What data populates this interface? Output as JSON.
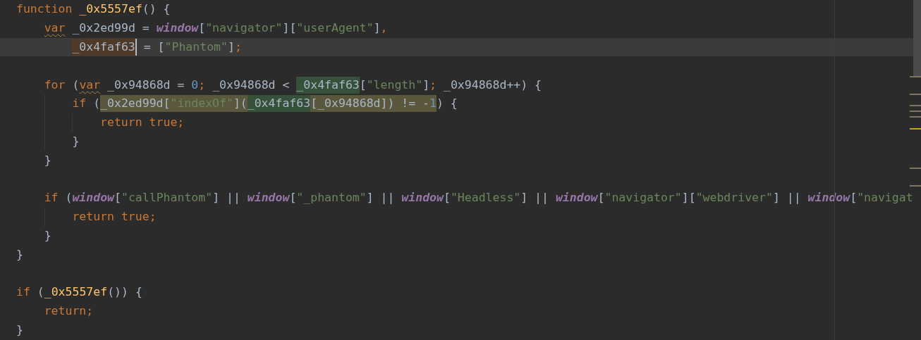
{
  "editor": {
    "lines": [
      {
        "current": false,
        "tokens": [
          {
            "text": "function ",
            "kind": "keyword"
          },
          {
            "text": "_0x5557ef",
            "kind": "function"
          },
          {
            "text": "() {",
            "kind": "plain"
          }
        ],
        "children": [
          {
            "current": false,
            "tokens": [
              {
                "text": "var",
                "kind": "keyword",
                "warning": true
              },
              {
                "text": " _0x2ed99d = ",
                "kind": "plain"
              },
              {
                "text": "window",
                "kind": "global"
              },
              {
                "text": "[",
                "kind": "plain"
              },
              {
                "text": "\"navigator\"",
                "kind": "string"
              },
              {
                "text": "][",
                "kind": "plain"
              },
              {
                "text": "\"userAgent\"",
                "kind": "string"
              },
              {
                "text": "]",
                "kind": "plain"
              },
              {
                "text": ",",
                "kind": "keyword"
              }
            ],
            "children": [
              {
                "current": true,
                "tokens": [
                  {
                    "text": "_0x4faf63",
                    "kind": "plain",
                    "write_usage": true,
                    "caret": true
                  },
                  {
                    "text": " = [",
                    "kind": "plain"
                  },
                  {
                    "text": "\"Phantom\"",
                    "kind": "string"
                  },
                  {
                    "text": "]",
                    "kind": "plain"
                  },
                  {
                    "text": ";",
                    "kind": "keyword"
                  }
                ]
              }
            ]
          },
          {
            "current": false
          },
          {
            "current": false,
            "tokens": [
              {
                "text": "for",
                "kind": "keyword"
              },
              {
                "text": " (",
                "kind": "plain"
              },
              {
                "text": "var",
                "kind": "keyword",
                "warning": true
              },
              {
                "text": " _0x94868d = ",
                "kind": "plain"
              },
              {
                "text": "0",
                "kind": "number"
              },
              {
                "text": ";",
                "kind": "keyword"
              },
              {
                "text": " _0x94868d < ",
                "kind": "plain"
              },
              {
                "text": "_0x4faf63",
                "kind": "plain",
                "read_usage": true
              },
              {
                "text": "[",
                "kind": "plain"
              },
              {
                "text": "\"length\"",
                "kind": "string"
              },
              {
                "text": "]",
                "kind": "plain"
              },
              {
                "text": ";",
                "kind": "keyword"
              },
              {
                "text": " _0x94868d++) {",
                "kind": "plain"
              }
            ],
            "children": [
              {
                "current": false,
                "tokens": [
                  {
                    "text": "if",
                    "kind": "keyword"
                  },
                  {
                    "text": " (",
                    "kind": "plain"
                  },
                  {
                    "text": "_0x2ed99d[",
                    "kind": "plain",
                    "search_match": true
                  },
                  {
                    "text": "\"indexOf\"",
                    "kind": "string",
                    "search_match": true
                  },
                  {
                    "text": "](",
                    "kind": "plain",
                    "search_match": true
                  },
                  {
                    "text": "_0x4faf63",
                    "kind": "plain",
                    "read_usage": true
                  },
                  {
                    "text": "[_0x94868d]) != -",
                    "kind": "plain",
                    "search_match": true
                  },
                  {
                    "text": "1",
                    "kind": "number",
                    "search_match": true
                  },
                  {
                    "text": ") {",
                    "kind": "plain"
                  }
                ],
                "children": [
                  {
                    "current": false,
                    "tokens": [
                      {
                        "text": "return ",
                        "kind": "keyword"
                      },
                      {
                        "text": "true",
                        "kind": "keyword"
                      },
                      {
                        "text": ";",
                        "kind": "keyword"
                      }
                    ]
                  }
                ]
              },
              {
                "current": false,
                "tokens": [
                  {
                    "text": "}",
                    "kind": "plain"
                  }
                ]
              }
            ]
          },
          {
            "current": false,
            "tokens": [
              {
                "text": "}",
                "kind": "plain"
              }
            ]
          },
          {
            "current": false
          },
          {
            "current": false,
            "tokens": [
              {
                "text": "if",
                "kind": "keyword"
              },
              {
                "text": " (",
                "kind": "plain"
              },
              {
                "text": "window",
                "kind": "global"
              },
              {
                "text": "[",
                "kind": "plain"
              },
              {
                "text": "\"callPhantom\"",
                "kind": "string"
              },
              {
                "text": "] || ",
                "kind": "plain"
              },
              {
                "text": "window",
                "kind": "global"
              },
              {
                "text": "[",
                "kind": "plain"
              },
              {
                "text": "\"_phantom\"",
                "kind": "string"
              },
              {
                "text": "] || ",
                "kind": "plain"
              },
              {
                "text": "window",
                "kind": "global"
              },
              {
                "text": "[",
                "kind": "plain"
              },
              {
                "text": "\"Headless\"",
                "kind": "string"
              },
              {
                "text": "] || ",
                "kind": "plain"
              },
              {
                "text": "window",
                "kind": "global"
              },
              {
                "text": "[",
                "kind": "plain"
              },
              {
                "text": "\"navigator\"",
                "kind": "string"
              },
              {
                "text": "][",
                "kind": "plain"
              },
              {
                "text": "\"webdriver\"",
                "kind": "string"
              },
              {
                "text": "] || ",
                "kind": "plain"
              },
              {
                "text": "window",
                "kind": "global"
              },
              {
                "text": "[",
                "kind": "plain"
              },
              {
                "text": "\"navigat",
                "kind": "string"
              }
            ],
            "children": [
              {
                "current": false,
                "tokens": [
                  {
                    "text": "return ",
                    "kind": "keyword"
                  },
                  {
                    "text": "true",
                    "kind": "keyword"
                  },
                  {
                    "text": ";",
                    "kind": "keyword"
                  }
                ]
              }
            ]
          },
          {
            "current": false,
            "tokens": [
              {
                "text": "}",
                "kind": "plain"
              }
            ]
          }
        ]
      },
      {
        "current": false,
        "tokens": [
          {
            "text": "}",
            "kind": "plain"
          }
        ]
      },
      {
        "current": false
      },
      {
        "current": false,
        "tokens": [
          {
            "text": "if",
            "kind": "keyword"
          },
          {
            "text": " (",
            "kind": "plain"
          },
          {
            "text": "_0x5557ef",
            "kind": "function"
          },
          {
            "text": "()) {",
            "kind": "plain"
          }
        ],
        "children": [
          {
            "current": false,
            "tokens": [
              {
                "text": "return",
                "kind": "keyword"
              },
              {
                "text": ";",
                "kind": "keyword"
              }
            ]
          }
        ]
      },
      {
        "current": false,
        "tokens": [
          {
            "text": "}",
            "kind": "plain"
          }
        ]
      }
    ]
  }
}
